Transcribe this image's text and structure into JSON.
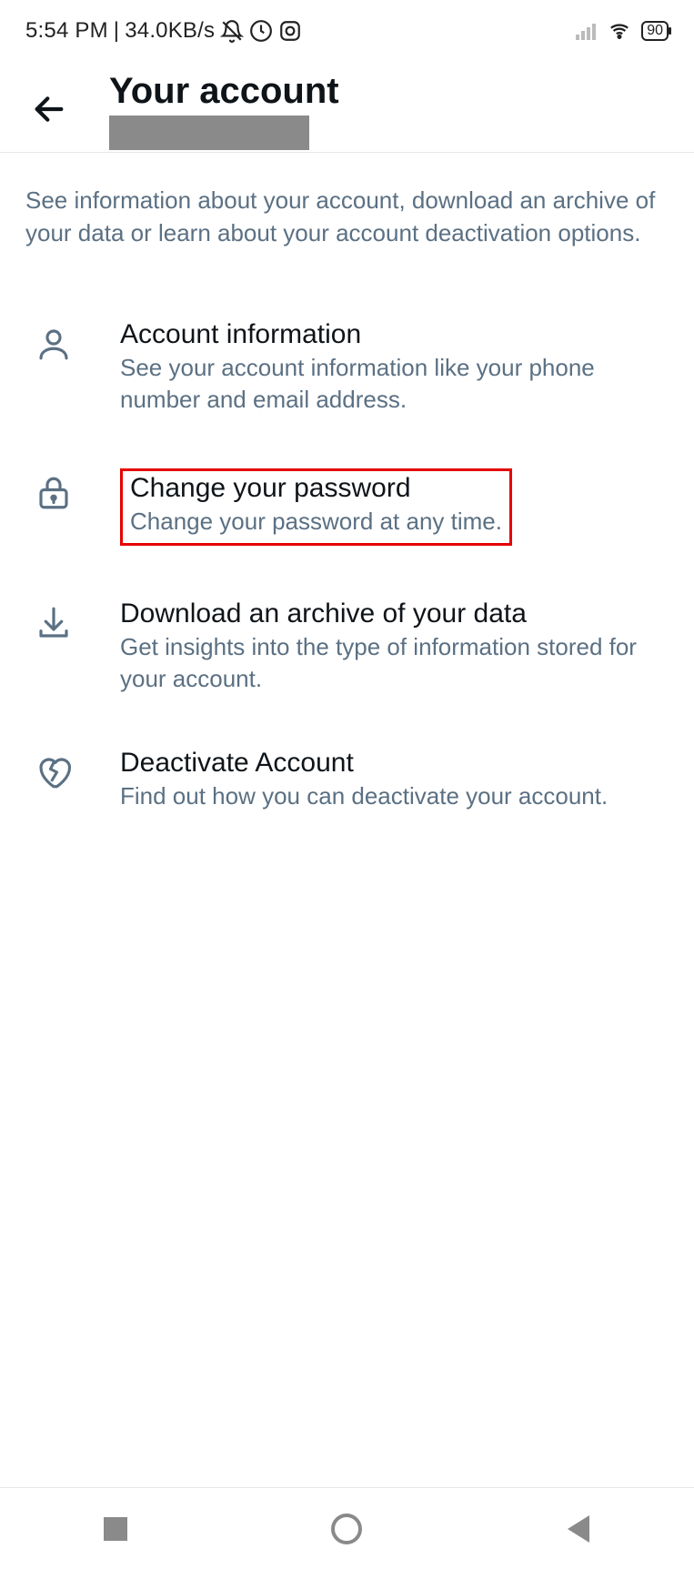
{
  "status": {
    "time": "5:54 PM",
    "sep": "|",
    "net_speed": "34.0KB/s",
    "battery_pct": "90"
  },
  "header": {
    "title": "Your account"
  },
  "intro": "See information about your account, download an archive of your data or learn about your account deactivation options.",
  "menu": {
    "account_info": {
      "title": "Account information",
      "sub": "See your account information like your phone number and email address."
    },
    "change_password": {
      "title": "Change your password",
      "sub": "Change your password at any time."
    },
    "download_archive": {
      "title": "Download an archive of your data",
      "sub": "Get insights into the type of information stored for your account."
    },
    "deactivate": {
      "title": "Deactivate Account",
      "sub": "Find out how you can deactivate your account."
    }
  }
}
